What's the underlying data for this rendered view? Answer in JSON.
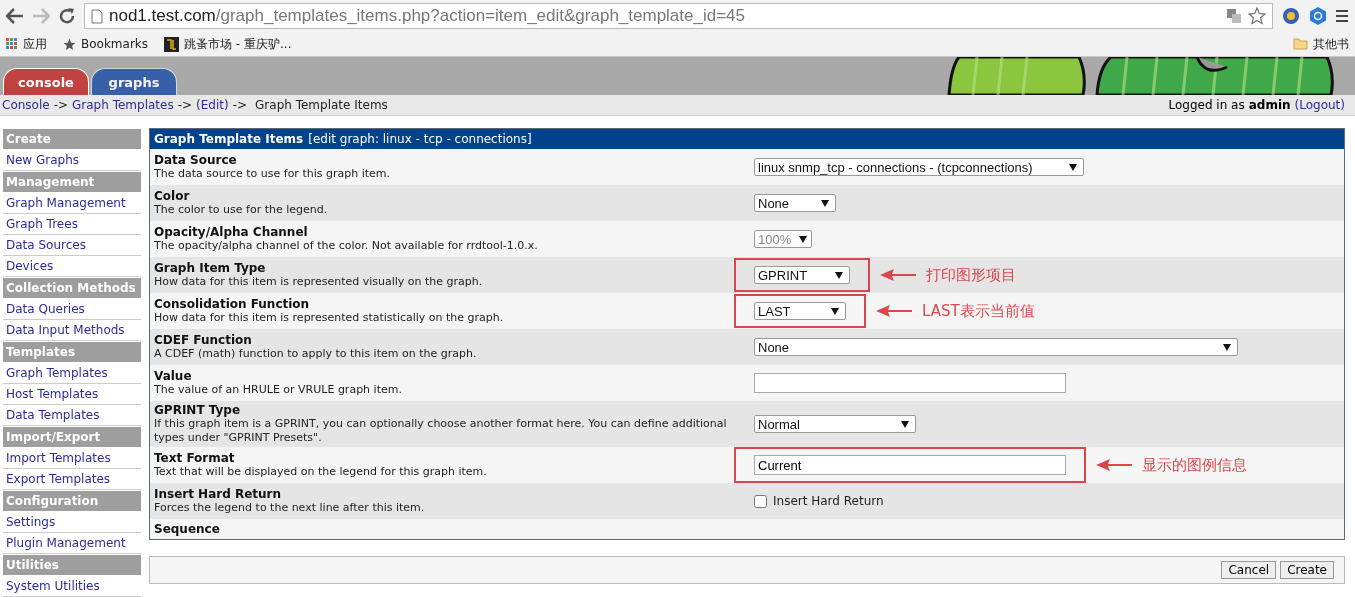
{
  "browser": {
    "url_host": "nod1.test.com",
    "url_path": "/graph_templates_items.php?action=item_edit&graph_template_id=45",
    "bookmarks": [
      {
        "kind": "apps",
        "label": "应用"
      },
      {
        "kind": "star",
        "label": "Bookmarks"
      },
      {
        "kind": "site",
        "label": "跳蚤市场 - 重庆驴..."
      }
    ],
    "other_bookmarks": "其他书"
  },
  "tabs": [
    {
      "label": "console",
      "selected": true,
      "color": "#c0413f"
    },
    {
      "label": "graphs",
      "selected": false,
      "color": "#2f5aa8"
    }
  ],
  "breadcrumb": [
    {
      "kind": "link",
      "text": "Console"
    },
    {
      "kind": "sep",
      "text": "->"
    },
    {
      "kind": "link",
      "text": "Graph Templates"
    },
    {
      "kind": "sep",
      "text": "->"
    },
    {
      "kind": "link",
      "text": "(Edit)"
    },
    {
      "kind": "sep",
      "text": "->"
    },
    {
      "kind": "text",
      "text": "Graph Template Items"
    }
  ],
  "login": {
    "prefix": "Logged in as",
    "user": "admin",
    "logout": "(Logout)"
  },
  "sidebar": [
    {
      "kind": "heading",
      "label": "Create"
    },
    {
      "kind": "link",
      "label": "New Graphs"
    },
    {
      "kind": "heading",
      "label": "Management"
    },
    {
      "kind": "link",
      "label": "Graph Management"
    },
    {
      "kind": "link",
      "label": "Graph Trees"
    },
    {
      "kind": "link",
      "label": "Data Sources"
    },
    {
      "kind": "link",
      "label": "Devices"
    },
    {
      "kind": "heading",
      "label": "Collection Methods"
    },
    {
      "kind": "link",
      "label": "Data Queries"
    },
    {
      "kind": "link",
      "label": "Data Input Methods"
    },
    {
      "kind": "heading",
      "label": "Templates"
    },
    {
      "kind": "link",
      "label": "Graph Templates"
    },
    {
      "kind": "link",
      "label": "Host Templates"
    },
    {
      "kind": "link",
      "label": "Data Templates"
    },
    {
      "kind": "heading",
      "label": "Import/Export"
    },
    {
      "kind": "link",
      "label": "Import Templates"
    },
    {
      "kind": "link",
      "label": "Export Templates"
    },
    {
      "kind": "heading",
      "label": "Configuration"
    },
    {
      "kind": "link",
      "label": "Settings"
    },
    {
      "kind": "link",
      "label": "Plugin Management"
    },
    {
      "kind": "heading",
      "label": "Utilities"
    },
    {
      "kind": "link",
      "label": "System Utilities"
    }
  ],
  "form": {
    "title": "Graph Template Items",
    "subtitle": "[edit graph: linux - tcp - connections]",
    "rows": [
      {
        "label": "Data Source",
        "description": "The data source to use for this graph item.",
        "field": {
          "kind": "select",
          "value": "linux snmp_tcp - connections - (tcpconnections)",
          "disabled": false
        }
      },
      {
        "label": "Color",
        "description": "The color to use for the legend.",
        "field": {
          "kind": "select",
          "value": "None",
          "disabled": false
        }
      },
      {
        "label": "Opacity/Alpha Channel",
        "description": "The opacity/alpha channel of the color. Not available for rrdtool-1.0.x.",
        "field": {
          "kind": "select",
          "value": "100%",
          "disabled": true
        }
      },
      {
        "label": "Graph Item Type",
        "description": "How data for this item is represented visually on the graph.",
        "field": {
          "kind": "select",
          "value": "GPRINT",
          "disabled": false
        },
        "annotation": "打印图形项目"
      },
      {
        "label": "Consolidation Function",
        "description": "How data for this item is represented statistically on the graph.",
        "field": {
          "kind": "select",
          "value": "LAST",
          "disabled": false
        },
        "annotation": "LAST表示当前值"
      },
      {
        "label": "CDEF Function",
        "description": "A CDEF (math) function to apply to this item on the graph.",
        "field": {
          "kind": "select",
          "value": "None",
          "disabled": false
        }
      },
      {
        "label": "Value",
        "description": "The value of an HRULE or VRULE graph item.",
        "field": {
          "kind": "text"
        }
      },
      {
        "label": "GPRINT Type",
        "description": "If this graph item is a GPRINT, you can optionally choose another format here. You can define additional types under \"GPRINT Presets\".",
        "field": {
          "kind": "select",
          "value": "Normal",
          "disabled": false
        }
      },
      {
        "label": "Text Format",
        "description": "Text that will be displayed on the legend for this graph item.",
        "field": {
          "kind": "text",
          "value": "Current"
        },
        "annotation": "显示的图例信息"
      },
      {
        "label": "Insert Hard Return",
        "description": "Forces the legend to the next line after this item.",
        "field": {
          "kind": "checkbox",
          "checked": false,
          "label": "Insert Hard Return"
        }
      },
      {
        "label": "Sequence"
      }
    ]
  },
  "buttons": [
    "Cancel",
    "Create"
  ]
}
